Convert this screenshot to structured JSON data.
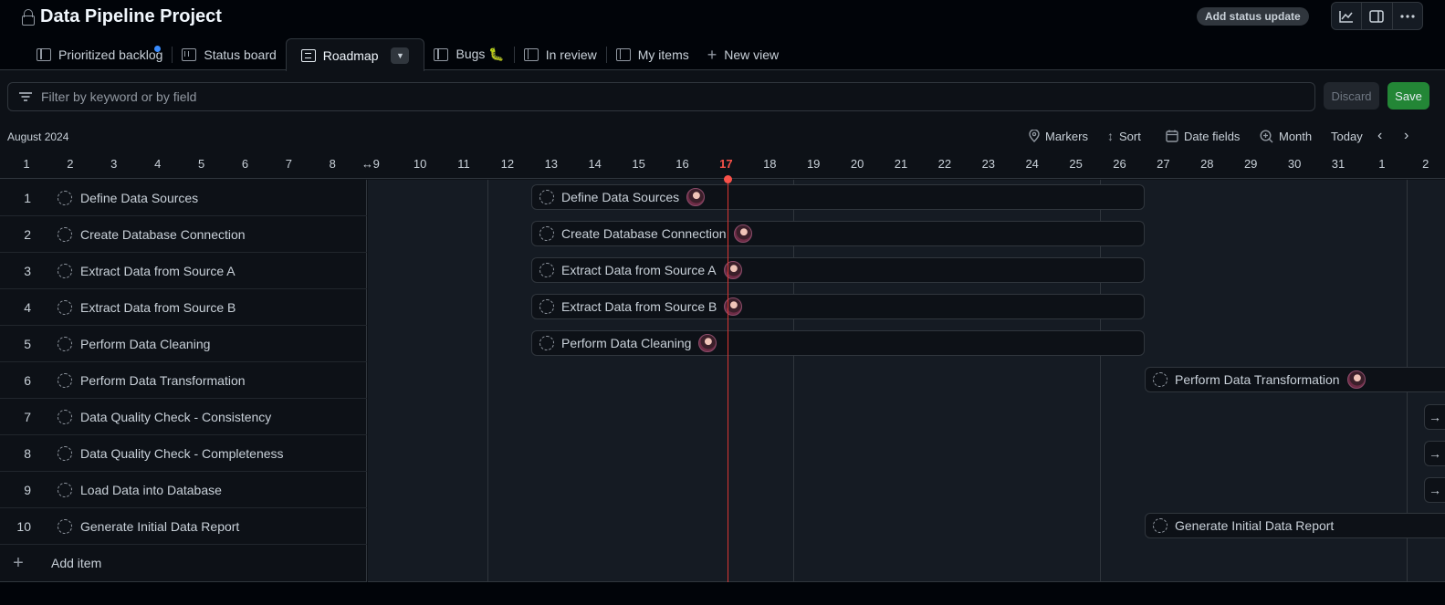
{
  "project": {
    "title": "Data Pipeline Project",
    "status_button": "Add status update"
  },
  "tabs": [
    {
      "label": "Prioritized backlog",
      "icon": "table-icon"
    },
    {
      "label": "Status board",
      "icon": "board-icon"
    },
    {
      "label": "Roadmap",
      "icon": "roadmap-icon"
    },
    {
      "label": "Bugs 🐛",
      "icon": "table-icon"
    },
    {
      "label": "In review",
      "icon": "table-icon"
    },
    {
      "label": "My items",
      "icon": "table-icon"
    },
    {
      "label": "New view",
      "icon": "plus-icon"
    }
  ],
  "filter": {
    "placeholder": "Filter by keyword or by field"
  },
  "buttons": {
    "discard": "Discard",
    "save": "Save"
  },
  "timeline": {
    "month_label": "August 2024",
    "today": "17",
    "toolbar": {
      "markers": "Markers",
      "sort": "Sort",
      "date_fields": "Date fields",
      "zoom": "Month",
      "today": "Today"
    },
    "days": [
      "1",
      "2",
      "3",
      "4",
      "5",
      "6",
      "7",
      "8",
      "9",
      "10",
      "11",
      "12",
      "13",
      "14",
      "15",
      "16",
      "17",
      "18",
      "19",
      "20",
      "21",
      "22",
      "23",
      "24",
      "25",
      "26",
      "27",
      "28",
      "29",
      "30",
      "31",
      "1",
      "2"
    ]
  },
  "items": [
    {
      "num": "1",
      "title": "Define Data Sources",
      "start": "Aug 13",
      "end": "Aug 27"
    },
    {
      "num": "2",
      "title": "Create Database Connection",
      "start": "Aug 13",
      "end": "Aug 27"
    },
    {
      "num": "3",
      "title": "Extract Data from Source A",
      "start": "Aug 13",
      "end": "Aug 27"
    },
    {
      "num": "4",
      "title": "Extract Data from Source B",
      "start": "Aug 13",
      "end": "Aug 27"
    },
    {
      "num": "5",
      "title": "Perform Data Cleaning",
      "start": "Aug 13",
      "end": "Aug 27"
    },
    {
      "num": "6",
      "title": "Perform Data Transformation",
      "start": "Aug 27",
      "end": "Sep 2+"
    },
    {
      "num": "7",
      "title": "Data Quality Check - Consistency",
      "start": "",
      "end": ""
    },
    {
      "num": "8",
      "title": "Data Quality Check - Completeness",
      "start": "",
      "end": ""
    },
    {
      "num": "9",
      "title": "Load Data into Database",
      "start": "",
      "end": ""
    },
    {
      "num": "10",
      "title": "Generate Initial Data Report",
      "start": "Aug 27",
      "end": "Sep 2+"
    }
  ],
  "add_item": "Add item"
}
